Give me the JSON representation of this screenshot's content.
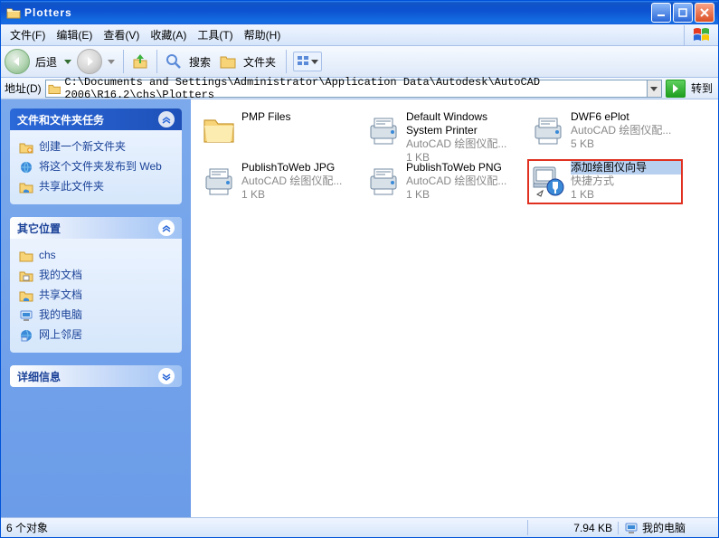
{
  "window": {
    "title": "Plotters"
  },
  "menu": {
    "file": "文件(F)",
    "edit": "编辑(E)",
    "view": "查看(V)",
    "fav": "收藏(A)",
    "tools": "工具(T)",
    "help": "帮助(H)"
  },
  "toolbar": {
    "back": "后退",
    "search": "搜索",
    "folders": "文件夹"
  },
  "address": {
    "label": "地址(D)",
    "path": "C:\\Documents and Settings\\Administrator\\Application Data\\Autodesk\\AutoCAD 2006\\R16.2\\chs\\Plotters",
    "go": "转到"
  },
  "sidebar": {
    "panel1": {
      "title": "文件和文件夹任务",
      "items": [
        "创建一个新文件夹",
        "将这个文件夹发布到 Web",
        "共享此文件夹"
      ]
    },
    "panel2": {
      "title": "其它位置",
      "items": [
        "chs",
        "我的文档",
        "共享文档",
        "我的电脑",
        "网上邻居"
      ]
    },
    "panel3": {
      "title": "详细信息"
    }
  },
  "files": [
    {
      "name": "PMP Files",
      "meta1": "",
      "meta2": "",
      "type": "folder"
    },
    {
      "name": "Default Windows System Printer",
      "meta1": "AutoCAD 绘图仪配...",
      "meta2": "1 KB",
      "type": "plotter"
    },
    {
      "name": "DWF6 ePlot",
      "meta1": "AutoCAD 绘图仪配...",
      "meta2": "5 KB",
      "type": "plotter"
    },
    {
      "name": "PublishToWeb JPG",
      "meta1": "AutoCAD 绘图仪配...",
      "meta2": "1 KB",
      "type": "plotter"
    },
    {
      "name": "PublishToWeb PNG",
      "meta1": "AutoCAD 绘图仪配...",
      "meta2": "1 KB",
      "type": "plotter"
    },
    {
      "name": "添加绘图仪向导",
      "meta1": "快捷方式",
      "meta2": "1 KB",
      "type": "wizard",
      "selected": true
    }
  ],
  "status": {
    "objects": "6 个对象",
    "size": "7.94 KB",
    "location": "我的电脑"
  }
}
